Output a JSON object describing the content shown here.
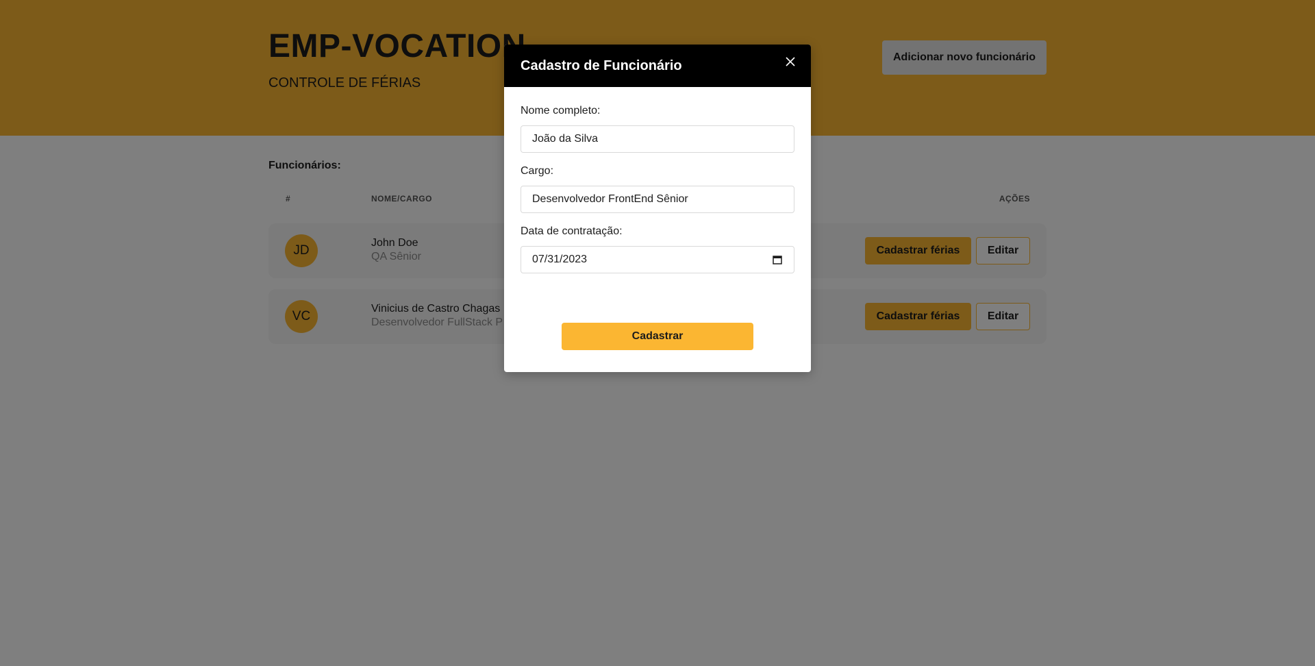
{
  "header": {
    "title": "EMP-VOCATION",
    "subtitle": "CONTROLE DE FÉRIAS",
    "add_button_label": "Adicionar novo funcionário"
  },
  "main": {
    "section_title": "Funcionários:",
    "columns": [
      "#",
      "NOME/CARGO",
      "AÇÕES"
    ],
    "employees": [
      {
        "initials": "JD",
        "name": "John Doe",
        "role": "QA Sênior",
        "vacation_label": "Cadastrar férias",
        "edit_label": "Editar"
      },
      {
        "initials": "VC",
        "name": "Vinicius de Castro Chagas",
        "role": "Desenvolvedor FullStack P",
        "vacation_label": "Cadastrar férias",
        "edit_label": "Editar"
      }
    ]
  },
  "modal": {
    "title": "Cadastro de Funcionário",
    "close_icon": "close-icon",
    "fields": {
      "name": {
        "label": "Nome completo:",
        "value": "João da Silva"
      },
      "role": {
        "label": "Cargo:",
        "value": "Desenvolvedor FrontEnd Sênior"
      },
      "hire_date": {
        "label": "Data de contratação:",
        "value": "07/31/2023"
      }
    },
    "submit_label": "Cadastrar"
  },
  "colors": {
    "accent": "#fbb632",
    "modal_header": "#000000",
    "overlay": "rgba(0,0,0,0.5)"
  }
}
